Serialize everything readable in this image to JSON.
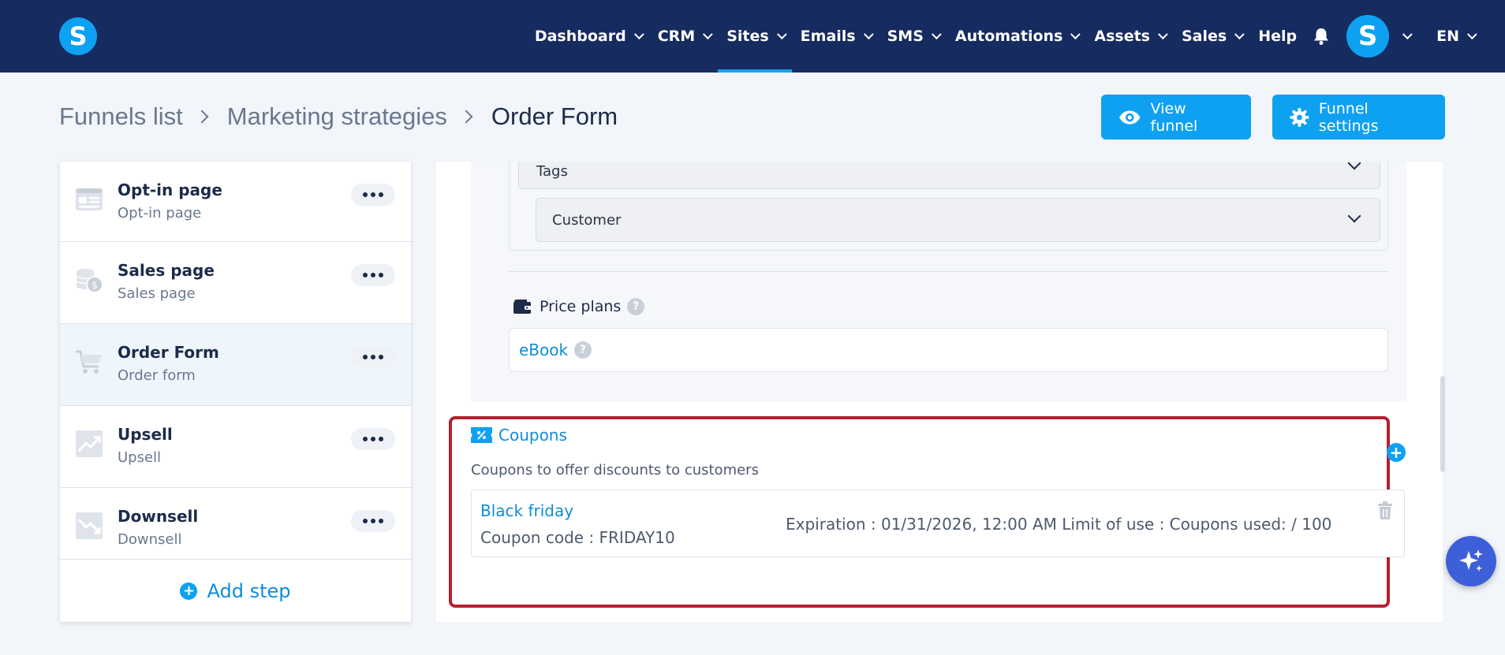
{
  "app": {
    "logo_letter": "S"
  },
  "nav": {
    "items": [
      {
        "label": "Dashboard",
        "has_menu": true
      },
      {
        "label": "CRM",
        "has_menu": true
      },
      {
        "label": "Sites",
        "has_menu": true,
        "active": true
      },
      {
        "label": "Emails",
        "has_menu": true
      },
      {
        "label": "SMS",
        "has_menu": true
      },
      {
        "label": "Automations",
        "has_menu": true
      },
      {
        "label": "Assets",
        "has_menu": true
      },
      {
        "label": "Sales",
        "has_menu": true
      },
      {
        "label": "Help",
        "has_menu": false
      }
    ],
    "avatar_letter": "S",
    "language": "EN"
  },
  "breadcrumb": {
    "funnels_list": "Funnels list",
    "marketing": "Marketing strategies",
    "current": "Order Form"
  },
  "actions": {
    "view_funnel": "View funnel",
    "funnel_settings": "Funnel settings"
  },
  "steps": [
    {
      "title": "Opt-in page",
      "subtitle": "Opt-in page",
      "icon": "optin-page-icon"
    },
    {
      "title": "Sales page",
      "subtitle": "Sales page",
      "icon": "coins-icon"
    },
    {
      "title": "Order Form",
      "subtitle": "Order form",
      "icon": "cart-icon",
      "active": true
    },
    {
      "title": "Upsell",
      "subtitle": "Upsell",
      "icon": "trend-up-icon"
    },
    {
      "title": "Downsell",
      "subtitle": "Downsell",
      "icon": "trend-down-icon"
    }
  ],
  "add_step": "Add step",
  "form": {
    "tags_label": "Tags",
    "customer_value": "Customer",
    "price_plans_label": "Price plans",
    "price_plan": "eBook"
  },
  "coupons": {
    "title": "Coupons",
    "description": "Coupons to offer discounts to customers",
    "items": [
      {
        "name": "Black friday",
        "code": "Coupon code : FRIDAY10",
        "meta": "Expiration : 01/31/2026, 12:00 AM   Limit of use : Coupons used: / 100"
      }
    ]
  },
  "colors": {
    "nav_bg": "#162b5f",
    "accent": "#0ea1f2",
    "highlight_border": "#b3212f"
  }
}
